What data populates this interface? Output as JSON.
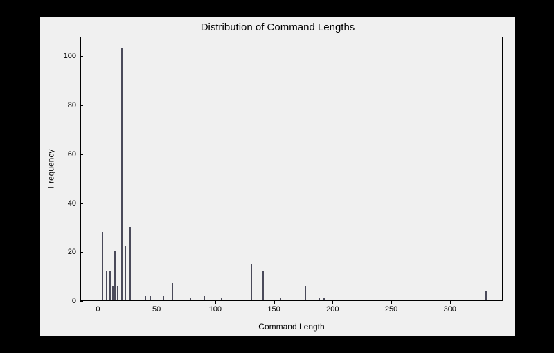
{
  "chart_data": {
    "type": "bar",
    "title": "Distribution of Command Lengths",
    "xlabel": "Command Length",
    "ylabel": "Frequency",
    "xlim": [
      -15,
      345
    ],
    "ylim": [
      0,
      108
    ],
    "x_ticks": [
      0,
      50,
      100,
      150,
      200,
      250,
      300
    ],
    "y_ticks": [
      0,
      20,
      40,
      60,
      80,
      100
    ],
    "bars": [
      {
        "x": 3,
        "y": 28
      },
      {
        "x": 7,
        "y": 12
      },
      {
        "x": 10,
        "y": 12
      },
      {
        "x": 12,
        "y": 6
      },
      {
        "x": 14,
        "y": 20
      },
      {
        "x": 16,
        "y": 6
      },
      {
        "x": 20,
        "y": 103
      },
      {
        "x": 23,
        "y": 22
      },
      {
        "x": 27,
        "y": 30
      },
      {
        "x": 40,
        "y": 2
      },
      {
        "x": 44,
        "y": 2
      },
      {
        "x": 55,
        "y": 2
      },
      {
        "x": 63,
        "y": 7
      },
      {
        "x": 78,
        "y": 1
      },
      {
        "x": 90,
        "y": 2
      },
      {
        "x": 105,
        "y": 1
      },
      {
        "x": 130,
        "y": 15
      },
      {
        "x": 140,
        "y": 12
      },
      {
        "x": 155,
        "y": 1
      },
      {
        "x": 176,
        "y": 6
      },
      {
        "x": 188,
        "y": 1
      },
      {
        "x": 192,
        "y": 1
      },
      {
        "x": 330,
        "y": 4
      }
    ]
  }
}
